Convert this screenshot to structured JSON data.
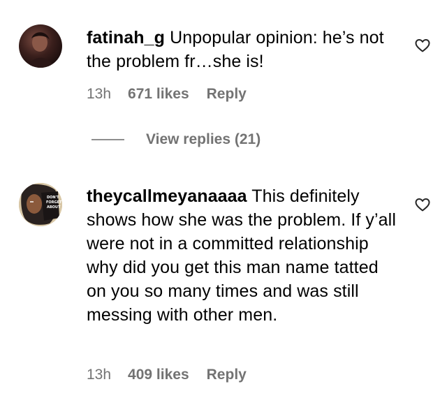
{
  "comments": [
    {
      "username": "fatinah_g",
      "text": "Unpopular opinion: he’s not the problem fr…she is!",
      "time": "13h",
      "likes": "671 likes",
      "reply_label": "Reply",
      "avatar_icon": "profile-photo",
      "like_icon": "heart-outline-icon"
    },
    {
      "username": "theycallmeyanaaaa",
      "text": "This definitely shows how she was the problem. If y’all were not in a committed relationship why did you get this man name tatted on you so many times and was still messing with other men.",
      "time": "13h",
      "likes": "409 likes",
      "reply_label": "Reply",
      "avatar_icon": "profile-photo",
      "like_icon": "heart-outline-icon"
    }
  ],
  "view_replies": {
    "label": "View replies (21)"
  },
  "colors": {
    "text": "#000000",
    "meta": "#737373",
    "background": "#ffffff"
  }
}
